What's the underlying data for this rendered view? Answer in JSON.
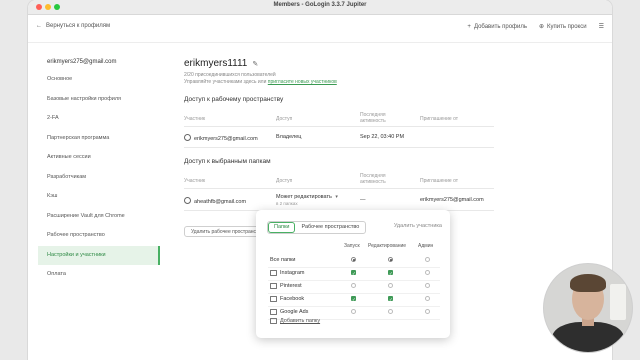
{
  "window": {
    "title": "Members - GoLogin 3.3.7 Jupiter"
  },
  "toolbar": {
    "back_label": "Вернуться к профилям",
    "add_profile_label": "Добавить профиль",
    "buy_proxy_label": "Купить прокси"
  },
  "sidebar": {
    "email": "erikmyers275@gmail.com",
    "items": [
      {
        "label": "Основное"
      },
      {
        "label": "Базовые настройки профиля"
      },
      {
        "label": "2-FA"
      },
      {
        "label": "Партнерская программа"
      },
      {
        "label": "Активные сессии"
      },
      {
        "label": "Разработчикам"
      },
      {
        "label": "Кэш"
      },
      {
        "label": "Расширение Vault для Chrome"
      },
      {
        "label": "Рабочее пространство"
      },
      {
        "label": "Настройки и участники"
      },
      {
        "label": "Оплата"
      }
    ]
  },
  "main": {
    "username": "erikmyers1111",
    "members_info": "2/20 присоединившихся пользователей",
    "manage_text": "Управляйте участниками здесь или",
    "invite_link": "пригласите новых участников",
    "workspace_access_title": "Доступ к рабочему пространству",
    "workspace_table": {
      "headers": {
        "member": "Участник",
        "access": "Доступ",
        "last_activity": "Последняя активность",
        "invitation": "Приглашение от"
      },
      "rows": [
        {
          "member": "erikmyers275@gmail.com",
          "access": "Владелец",
          "last_activity": "Sep 22, 03:40 PM",
          "invitation": ""
        }
      ]
    },
    "folders_access_title": "Доступ к выбранным папкам",
    "folders_table": {
      "headers": {
        "member": "Участник",
        "access": "Доступ",
        "last_activity": "Последняя активность",
        "invitation": "Приглашение от"
      },
      "rows": [
        {
          "member": "aheathfb@gmail.com",
          "access": "Может редактировать",
          "access_sub": "в 2 папках",
          "last_activity": "—",
          "invitation": "erikmyers275@gmail.com"
        }
      ]
    },
    "delete_button": "Удалить рабочее пространство"
  },
  "popup": {
    "tabs": [
      {
        "label": "Папки"
      },
      {
        "label": "Рабочее пространство"
      }
    ],
    "remove_member": "Удалить участника",
    "columns": {
      "launch": "Запуск",
      "edit": "Редактирование",
      "admin": "Админ"
    },
    "all_folders": "Все папки",
    "folders": [
      {
        "name": "Instagram",
        "launch": true,
        "edit": true,
        "admin": false
      },
      {
        "name": "Pinterest",
        "launch": false,
        "edit": false,
        "admin": false
      },
      {
        "name": "Facebook",
        "launch": true,
        "edit": true,
        "admin": false
      },
      {
        "name": "Google Ads",
        "launch": false,
        "edit": false,
        "admin": false
      }
    ],
    "add_folder": "Добавить папку"
  },
  "colors": {
    "accent": "#48b063",
    "accent_dark": "#2f8a45",
    "active_bg": "#e6f3e8"
  }
}
